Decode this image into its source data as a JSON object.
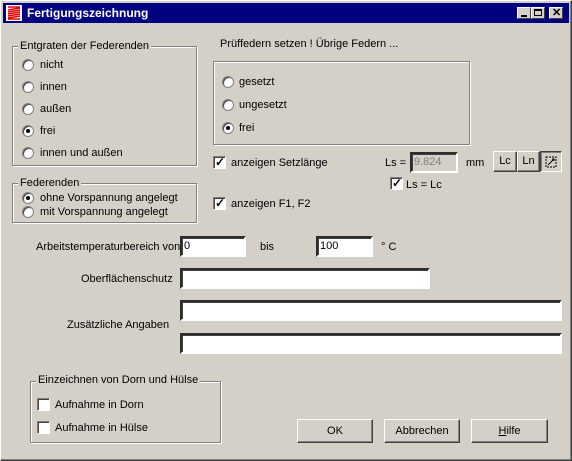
{
  "window": {
    "title": "Fertigungszeichnung"
  },
  "entgraten": {
    "title": "Entgraten der Federenden",
    "options": [
      "nicht",
      "innen",
      "außen",
      "frei",
      "innen und außen"
    ],
    "selected": "frei"
  },
  "federenden": {
    "title": "Federenden",
    "options": [
      "ohne Vorspannung angelegt",
      "mit Vorspannung angelegt"
    ],
    "selected": "ohne Vorspannung angelegt"
  },
  "pruef": {
    "heading": "Prüffedern setzen !  Übrige Federn ...",
    "options": [
      "gesetzt",
      "ungesetzt",
      "frei"
    ],
    "selected": "frei"
  },
  "setzlaenge": {
    "label": "anzeigen Setzlänge",
    "checked": true
  },
  "ls": {
    "label": "Ls =",
    "value": "9.824",
    "unit": "mm",
    "eq_label": "Ls = Lc",
    "eq_checked": true
  },
  "ls_buttons": {
    "lc": "Lc",
    "ln": "Ln"
  },
  "f1f2": {
    "label": "anzeigen F1, F2",
    "checked": true
  },
  "temp": {
    "label": "Arbeitstemperaturbereich von",
    "from": "0",
    "bis": "bis",
    "to": "100",
    "unit": "° C"
  },
  "oberflaeche": {
    "label": "Oberflächenschutz",
    "value": ""
  },
  "zusatz": {
    "label": "Zusätzliche Angaben",
    "line1": "",
    "line2": ""
  },
  "dorn": {
    "title": "Einzeichnen von Dorn und Hülse",
    "items": [
      {
        "label": "Aufnahme in Dorn",
        "checked": false
      },
      {
        "label": "Aufnahme in Hülse",
        "checked": false
      }
    ]
  },
  "buttons": {
    "ok": "OK",
    "cancel": "Abbrechen",
    "help": "Hilfe"
  }
}
